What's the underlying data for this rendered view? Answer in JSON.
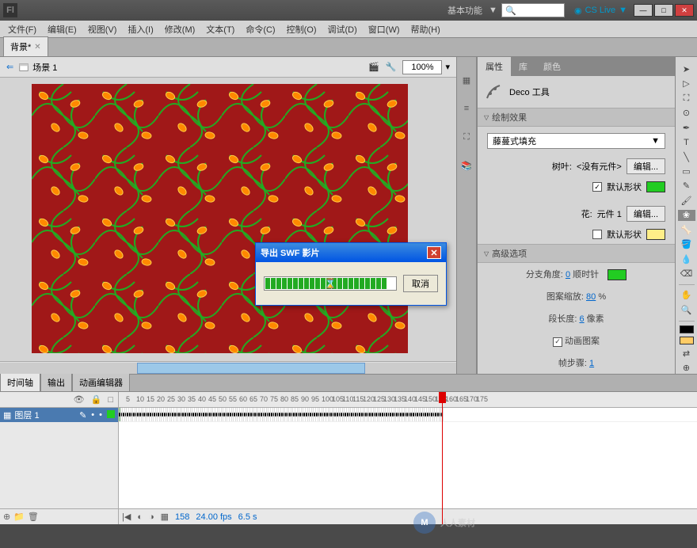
{
  "titlebar": {
    "logo": "Fl",
    "workspace": "基本功能",
    "cslive": "CS Live"
  },
  "menu": [
    "文件(F)",
    "编辑(E)",
    "视图(V)",
    "插入(I)",
    "修改(M)",
    "文本(T)",
    "命令(C)",
    "控制(O)",
    "调试(D)",
    "窗口(W)",
    "帮助(H)"
  ],
  "doc_tab": "背景*",
  "scene": {
    "name": "场景 1",
    "zoom": "100%"
  },
  "panels": {
    "tabs": [
      "属性",
      "库",
      "颜色"
    ],
    "tool_name": "Deco 工具",
    "sections": {
      "draw_effect": "绘制效果",
      "fill_type": "藤蔓式填充",
      "leaf_label": "树叶:",
      "leaf_value": "<没有元件>",
      "edit": "编辑...",
      "default_shape": "默认形状",
      "flower_label": "花:",
      "flower_value": "元件 1",
      "advanced": "高级选项",
      "branch_angle_label": "分支角度:",
      "branch_angle_value": "0",
      "branch_angle_dir": "顺时针",
      "pattern_scale_label": "图案缩放:",
      "pattern_scale_value": "80",
      "pattern_scale_unit": "%",
      "seg_length_label": "段长度:",
      "seg_length_value": "6",
      "seg_length_unit": "像素",
      "animate_label": "动画图案",
      "frame_step_label": "帧步骤:",
      "frame_step_value": "1"
    },
    "colors": {
      "leaf": "#22cc22",
      "flower": "#ffee88",
      "branch": "#22cc22"
    }
  },
  "timeline": {
    "tabs": [
      "时间轴",
      "输出",
      "动画编辑器"
    ],
    "layer_name": "图层 1",
    "ruler": [
      5,
      10,
      15,
      20,
      25,
      30,
      35,
      40,
      45,
      50,
      55,
      60,
      65,
      70,
      75,
      80,
      85,
      90,
      95,
      100,
      105,
      110,
      115,
      120,
      125,
      130,
      135,
      140,
      145,
      150,
      155,
      160,
      165,
      170,
      175
    ],
    "current_frame": "158",
    "fps": "24.00 fps",
    "time": "6.5 s"
  },
  "dialog": {
    "title": "导出 SWF 影片",
    "cancel": "取消"
  },
  "watermark": "人人素材"
}
